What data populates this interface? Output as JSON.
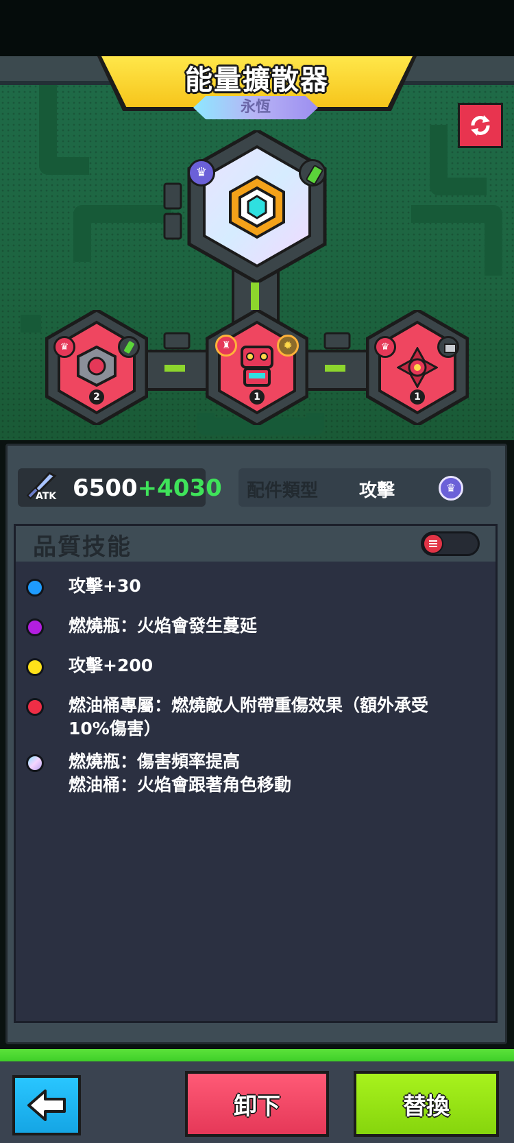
{
  "header": {
    "title": "能量擴散器",
    "rarity": "永恆"
  },
  "toolbar": {
    "refresh_icon": "refresh-arrows-icon"
  },
  "tree": {
    "main_node": {
      "icon": "energy-diffuser-icon",
      "rarity_badge": "crown-badge-icon",
      "type_badge": "molotov-bottle-icon"
    },
    "child_nodes": [
      {
        "icon": "hex-drone-icon",
        "badge": "crown-badge-icon",
        "type_badge": "molotov-bottle-icon",
        "count": "2"
      },
      {
        "icon": "robot-icon",
        "badge": "shield-badge-icon",
        "type_badge": "gear-badge-icon",
        "count": "1"
      },
      {
        "icon": "target-core-icon",
        "badge": "crown-badge-icon",
        "type_badge": "fuel-barrel-icon",
        "count": "1"
      }
    ]
  },
  "stats": {
    "atk_label": "ATK",
    "atk_base": "6500",
    "atk_bonus": "+4030",
    "type_label": "配件類型",
    "type_value": "攻擊"
  },
  "skills": {
    "title": "品質技能",
    "items": [
      {
        "text": "攻擊+30",
        "color": "#1e9bff"
      },
      {
        "text": "燃燒瓶：火焰會發生蔓延",
        "color": "#b21ee0"
      },
      {
        "text": "攻擊+200",
        "color": "#ffe11a"
      },
      {
        "text": "燃油桶專屬：燃燒敵人附帶重傷效果（額外承受\n10%傷害）",
        "color": "#ef2e46"
      },
      {
        "text": "燃燒瓶：傷害頻率提高\n燃油桶：火焰會跟著角色移動",
        "color": "#d9c7f5"
      }
    ]
  },
  "footer": {
    "back_icon": "arrow-left-icon",
    "unequip_label": "卸下",
    "replace_label": "替換"
  },
  "colors": {
    "accent_yellow": "#f6c51b",
    "node_red": "#e8344f",
    "bonus_green": "#3fe35a",
    "replace_green": "#a8f21d"
  }
}
